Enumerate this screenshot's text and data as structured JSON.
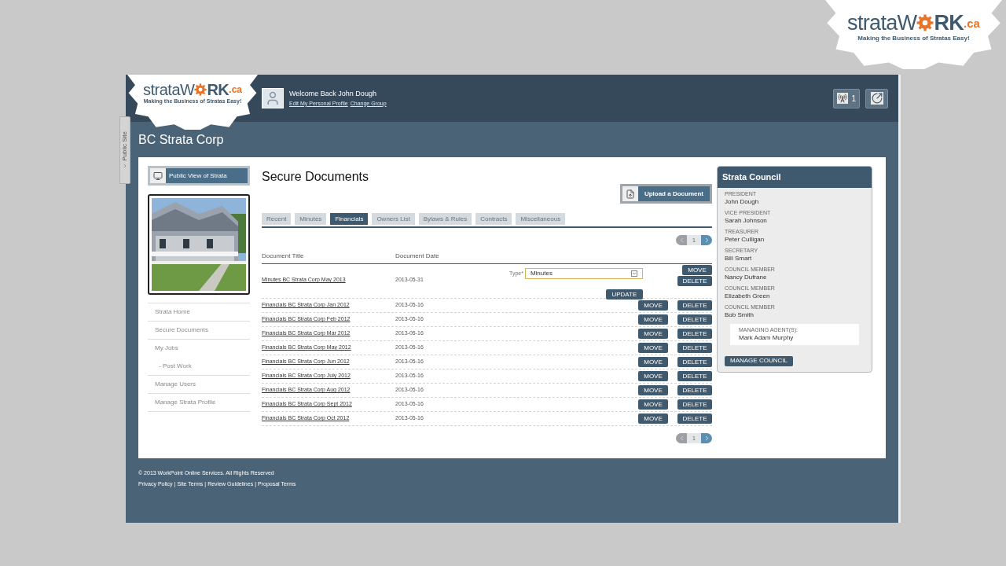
{
  "corner_logo": {
    "wordmark_start": "strataW",
    "wordmark_end": "RK",
    "domain": ".ca",
    "tagline": "Making the Business of Stratas Easy!"
  },
  "header_logo": {
    "wordmark_start": "strataW",
    "wordmark_end": "RK",
    "domain": ".ca",
    "tagline": "Making the Business of Stratas Easy!"
  },
  "user": {
    "welcome": "Welcome Back John Dough",
    "links": [
      "Edit My Personal Profile",
      "Change Group"
    ]
  },
  "notifications": {
    "count": "1"
  },
  "side_tab": {
    "label": "Public Site"
  },
  "page_title": "BC Strata Corp",
  "sidebar": {
    "public_view_button": "Public View of Strata",
    "items": [
      {
        "label": "Strata Home"
      },
      {
        "label": "Secure Documents"
      },
      {
        "label": "My Jobs",
        "children": [
          {
            "label": "- Post Work"
          }
        ]
      },
      {
        "label": "Manage Users"
      },
      {
        "label": "Manage Strata Profile"
      }
    ]
  },
  "main": {
    "heading": "Secure Documents",
    "upload_button": "Upload a Document",
    "tabs": [
      {
        "label": "Recent",
        "selected": false
      },
      {
        "label": "Minutes",
        "selected": false
      },
      {
        "label": "Financials",
        "selected": true
      },
      {
        "label": "Owners List",
        "selected": false
      },
      {
        "label": "Bylaws & Rules",
        "selected": false
      },
      {
        "label": "Contracts",
        "selected": false
      },
      {
        "label": "Miscellaneous",
        "selected": false
      }
    ],
    "pagination_top": {
      "page": "1"
    },
    "table": {
      "columns": [
        "Document Title",
        "Document Date"
      ],
      "rows": [
        {
          "kind": "editing",
          "title": "Minutes BC Strata Corp May 2013",
          "date": "2013-05-31",
          "type_label": "Type*",
          "type_value": "Minutes",
          "update": "UPDATE",
          "form_move": "MOVE",
          "delete": "DELETE"
        },
        {
          "kind": "normal",
          "title": "Financials BC Strata Corp Jan 2012",
          "date": "2013-05-16",
          "move": "MOVE",
          "delete": "DELETE"
        },
        {
          "kind": "normal",
          "title": "Financials BC Strata Corp Feb 2012",
          "date": "2013-05-16",
          "move": "MOVE",
          "delete": "DELETE"
        },
        {
          "kind": "normal",
          "title": "Financials BC Strata Corp Mar 2012",
          "date": "2013-05-16",
          "move": "MOVE",
          "delete": "DELETE"
        },
        {
          "kind": "normal",
          "title": "Financials BC Strata Corp May 2012",
          "date": "2013-05-16",
          "move": "MOVE",
          "delete": "DELETE"
        },
        {
          "kind": "normal",
          "title": "Financials BC Strata Corp Jun 2012",
          "date": "2013-05-16",
          "move": "MOVE",
          "delete": "DELETE"
        },
        {
          "kind": "normal",
          "title": "Financials BC Strata Corp July 2012",
          "date": "2013-05-16",
          "move": "MOVE",
          "delete": "DELETE"
        },
        {
          "kind": "normal",
          "title": "Financials BC Strata Corp Aug 2012",
          "date": "2013-05-16",
          "move": "MOVE",
          "delete": "DELETE"
        },
        {
          "kind": "normal",
          "title": "Financials BC Strata Corp Sept 2012",
          "date": "2013-05-16",
          "move": "MOVE",
          "delete": "DELETE"
        },
        {
          "kind": "normal",
          "title": "Financials BC Strata Corp Oct 2012",
          "date": "2013-05-16",
          "move": "MOVE",
          "delete": "DELETE"
        }
      ]
    },
    "pagination_bottom": {
      "page": "1"
    }
  },
  "council": {
    "title": "Strata Council",
    "members": [
      {
        "role": "PRESIDENT",
        "name": "John Dough"
      },
      {
        "role": "VICE PRESIDENT",
        "name": "Sarah Johnson"
      },
      {
        "role": "TREASURER",
        "name": "Peter Culligan"
      },
      {
        "role": "SECRETARY",
        "name": "Bill Smart"
      },
      {
        "role": "COUNCIL MEMBER",
        "name": "Nancy Dufrane"
      },
      {
        "role": "COUNCIL MEMBER",
        "name": "Elizabeth Green"
      },
      {
        "role": "COUNCIL MEMBER",
        "name": "Bob Smith"
      }
    ],
    "agent": {
      "role": "MANAGING AGENT(S):",
      "name": "Mark Adam Murphy"
    },
    "button": "MANAGE COUNCIL"
  },
  "footer": {
    "copyright": "© 2013 WorkPoint Online Services. All Rights Reserved",
    "links": [
      "Privacy Policy",
      "Site Terms",
      "Review Guidelines",
      "Proposal Terms"
    ],
    "separator": "|"
  }
}
